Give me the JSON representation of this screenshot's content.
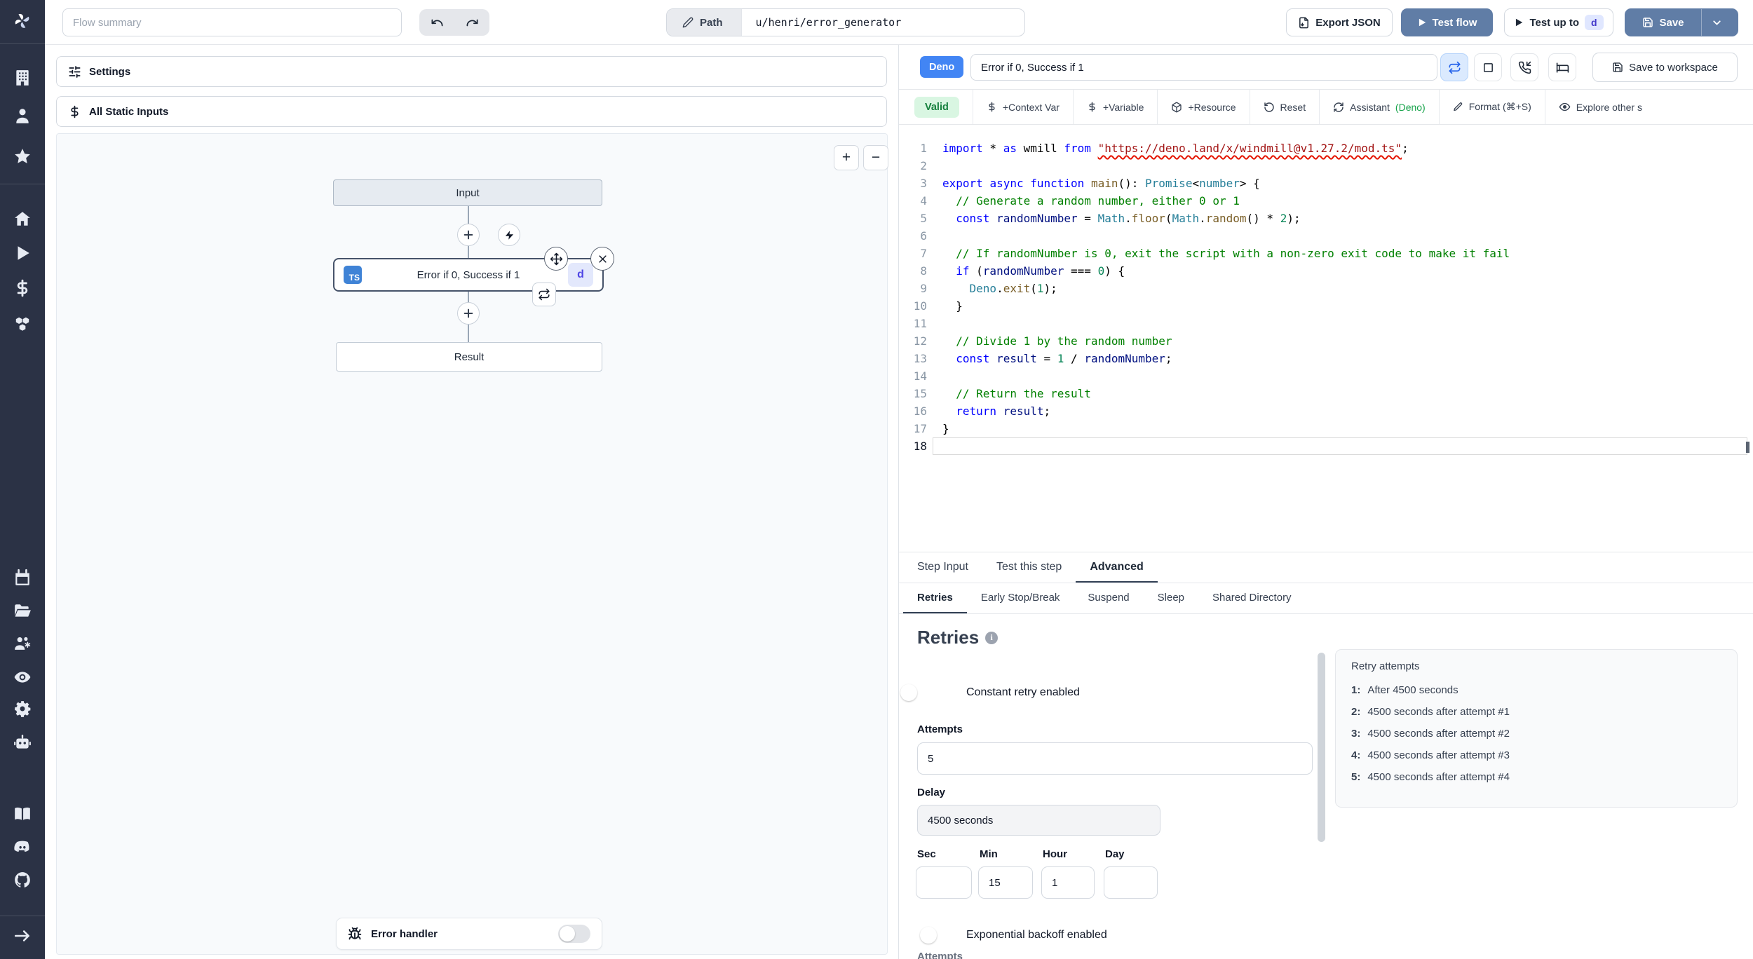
{
  "topbar": {
    "flow_summary_placeholder": "Flow summary",
    "path_label": "Path",
    "path_value": "u/henri/error_generator",
    "export_json_label": "Export JSON",
    "test_flow_label": "Test flow",
    "test_up_to_label": "Test up to",
    "test_up_to_badge": "d",
    "save_label": "Save"
  },
  "sidebar_icons": [
    "windmill-logo",
    "building",
    "user",
    "star",
    "home",
    "play",
    "dollar",
    "boxes",
    "calendar",
    "folder-open",
    "users-settings",
    "eye",
    "gear",
    "bot",
    "book",
    "discord",
    "github",
    "expand-arrow"
  ],
  "flow_panel": {
    "settings_label": "Settings",
    "all_static_inputs_label": "All Static Inputs",
    "zoom_in": "+",
    "zoom_out": "−",
    "canvas": {
      "input_node": "Input",
      "step_node": "Error if 0, Success if 1",
      "step_lang_badge": "TS",
      "step_suffix_badge": "d",
      "result_node": "Result",
      "error_handler_label": "Error handler"
    }
  },
  "right_panel": {
    "lang_badge": "Deno",
    "step_name": "Error if 0, Success if 1",
    "save_to_workspace_label": "Save to workspace",
    "toolbar": {
      "valid_label": "Valid",
      "context_var_label": "+Context Var",
      "variable_label": "+Variable",
      "resource_label": "+Resource",
      "reset_label": "Reset",
      "assistant_label": "Assistant",
      "assistant_lang": "(Deno)",
      "format_label": "Format (⌘+S)",
      "explore_label": "Explore other s"
    },
    "tabs": [
      "Step Input",
      "Test this step",
      "Advanced"
    ],
    "subtabs": [
      "Retries",
      "Early Stop/Break",
      "Suspend",
      "Sleep",
      "Shared Directory"
    ],
    "code": {
      "lines": [
        {
          "n": 1,
          "tokens": [
            [
              "k",
              "import"
            ],
            [
              "p",
              " * "
            ],
            [
              "k",
              "as"
            ],
            [
              "p",
              " wmill "
            ],
            [
              "k",
              "from"
            ],
            [
              "p",
              " "
            ],
            [
              "sq",
              "\"https://deno.land/x/windmill@v1.27.2/mod.ts\""
            ],
            [
              "p",
              ";"
            ]
          ]
        },
        {
          "n": 2,
          "tokens": []
        },
        {
          "n": 3,
          "tokens": [
            [
              "k",
              "export"
            ],
            [
              "p",
              " "
            ],
            [
              "k",
              "async"
            ],
            [
              "p",
              " "
            ],
            [
              "k",
              "function"
            ],
            [
              "p",
              " "
            ],
            [
              "f",
              "main"
            ],
            [
              "p",
              "(): "
            ],
            [
              "t",
              "Promise"
            ],
            [
              "p",
              "<"
            ],
            [
              "t",
              "number"
            ],
            [
              "p",
              "> {"
            ]
          ]
        },
        {
          "n": 4,
          "tokens": [
            [
              "c",
              "  // Generate a random number, either 0 or 1"
            ]
          ]
        },
        {
          "n": 5,
          "tokens": [
            [
              "p",
              "  "
            ],
            [
              "k",
              "const"
            ],
            [
              "p",
              " "
            ],
            [
              "v",
              "randomNumber"
            ],
            [
              "p",
              " = "
            ],
            [
              "t",
              "Math"
            ],
            [
              "p",
              "."
            ],
            [
              "f",
              "floor"
            ],
            [
              "p",
              "("
            ],
            [
              "t",
              "Math"
            ],
            [
              "p",
              "."
            ],
            [
              "f",
              "random"
            ],
            [
              "p",
              "() * "
            ],
            [
              "n",
              "2"
            ],
            [
              "p",
              ");"
            ]
          ]
        },
        {
          "n": 6,
          "tokens": []
        },
        {
          "n": 7,
          "tokens": [
            [
              "c",
              "  // If randomNumber is 0, exit the script with a non-zero exit code to make it fail"
            ]
          ]
        },
        {
          "n": 8,
          "tokens": [
            [
              "p",
              "  "
            ],
            [
              "k",
              "if"
            ],
            [
              "p",
              " ("
            ],
            [
              "v",
              "randomNumber"
            ],
            [
              "p",
              " === "
            ],
            [
              "n",
              "0"
            ],
            [
              "p",
              ") {"
            ]
          ]
        },
        {
          "n": 9,
          "tokens": [
            [
              "p",
              "    "
            ],
            [
              "t",
              "Deno"
            ],
            [
              "p",
              "."
            ],
            [
              "f",
              "exit"
            ],
            [
              "p",
              "("
            ],
            [
              "n",
              "1"
            ],
            [
              "p",
              ");"
            ]
          ]
        },
        {
          "n": 10,
          "tokens": [
            [
              "p",
              "  }"
            ]
          ]
        },
        {
          "n": 11,
          "tokens": []
        },
        {
          "n": 12,
          "tokens": [
            [
              "c",
              "  // Divide 1 by the random number"
            ]
          ]
        },
        {
          "n": 13,
          "tokens": [
            [
              "p",
              "  "
            ],
            [
              "k",
              "const"
            ],
            [
              "p",
              " "
            ],
            [
              "v",
              "result"
            ],
            [
              "p",
              " = "
            ],
            [
              "n",
              "1"
            ],
            [
              "p",
              " / "
            ],
            [
              "v",
              "randomNumber"
            ],
            [
              "p",
              ";"
            ]
          ]
        },
        {
          "n": 14,
          "tokens": []
        },
        {
          "n": 15,
          "tokens": [
            [
              "c",
              "  // Return the result"
            ]
          ]
        },
        {
          "n": 16,
          "tokens": [
            [
              "p",
              "  "
            ],
            [
              "k",
              "return"
            ],
            [
              "p",
              " "
            ],
            [
              "v",
              "result"
            ],
            [
              "p",
              ";"
            ]
          ]
        },
        {
          "n": 17,
          "tokens": [
            [
              "p",
              "}"
            ]
          ]
        },
        {
          "n": 18,
          "tokens": [],
          "current": true
        }
      ]
    },
    "retries": {
      "title": "Retries",
      "constant_toggle_label": "Constant retry enabled",
      "attempts_label": "Attempts",
      "attempts_value": "5",
      "delay_label": "Delay",
      "delay_value": "4500 seconds",
      "sec_label": "Sec",
      "min_label": "Min",
      "hour_label": "Hour",
      "day_label": "Day",
      "sec_value": "",
      "min_value": "15",
      "hour_value": "1",
      "day_value": "",
      "exponential_toggle_label": "Exponential backoff enabled",
      "bottom_clipped_label": "Attempts"
    },
    "retry_attempts": {
      "title": "Retry attempts",
      "items": [
        {
          "n": "1:",
          "text": "After 4500 seconds"
        },
        {
          "n": "2:",
          "text": "4500 seconds after attempt #1"
        },
        {
          "n": "3:",
          "text": "4500 seconds after attempt #2"
        },
        {
          "n": "4:",
          "text": "4500 seconds after attempt #3"
        },
        {
          "n": "5:",
          "text": "4500 seconds after attempt #4"
        }
      ]
    }
  },
  "colors": {
    "rail_bg": "#2b3245",
    "primary_button_blue": "#607da6",
    "lang_badge_blue": "#4285f4",
    "toggle_on_blue": "#2563eb",
    "valid_green_bg": "#d9f6e2",
    "valid_green_text": "#15803d",
    "assistant_green": "#16a34a",
    "selected_node_border": "#46536a"
  }
}
